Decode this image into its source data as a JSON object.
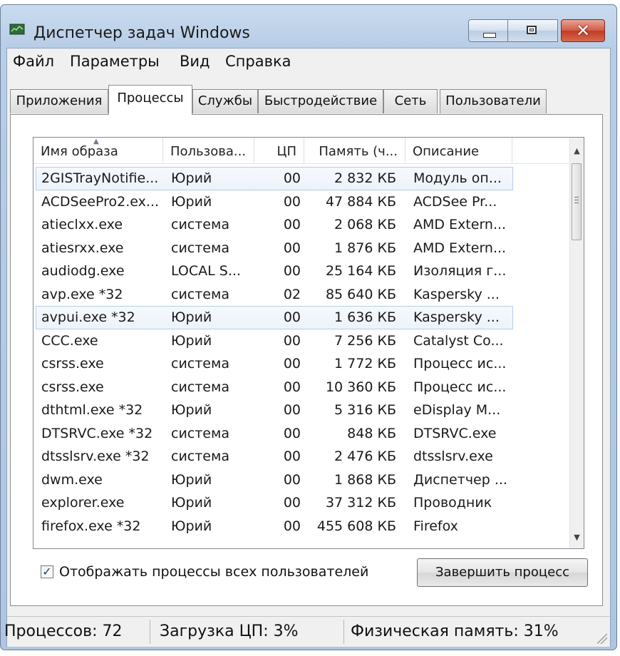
{
  "window": {
    "title": "Диспетчер задач Windows",
    "close_glyph": "✕"
  },
  "menu": [
    "Файл",
    "Параметры",
    "Вид",
    "Справка"
  ],
  "tabs": [
    "Приложения",
    "Процессы",
    "Службы",
    "Быстродействие",
    "Сеть",
    "Пользователи"
  ],
  "active_tab": "Процессы",
  "columns": {
    "name": "Имя образа",
    "user": "Пользова...",
    "cpu": "ЦП",
    "memory": "Память (ч...",
    "description": "Описание"
  },
  "processes": [
    {
      "name": "2GISTrayNotifie...",
      "user": "Юрий",
      "cpu": "00",
      "memory": "2 832 КБ",
      "description": "Модуль оп...",
      "selected": true
    },
    {
      "name": "ACDSeePro2.ex...",
      "user": "Юрий",
      "cpu": "00",
      "memory": "47 884 КБ",
      "description": "ACDSee Pr..."
    },
    {
      "name": "atieclxx.exe",
      "user": "система",
      "cpu": "00",
      "memory": "2 068 КБ",
      "description": "AMD Extern..."
    },
    {
      "name": "atiesrxx.exe",
      "user": "система",
      "cpu": "00",
      "memory": "1 876 КБ",
      "description": "AMD Extern..."
    },
    {
      "name": "audiodg.exe",
      "user": "LOCAL S...",
      "cpu": "00",
      "memory": "25 164 КБ",
      "description": "Изоляция г..."
    },
    {
      "name": "avp.exe *32",
      "user": "система",
      "cpu": "02",
      "memory": "85 640 КБ",
      "description": "Kaspersky ..."
    },
    {
      "name": "avpui.exe *32",
      "user": "Юрий",
      "cpu": "00",
      "memory": "1 636 КБ",
      "description": "Kaspersky ...",
      "selected": true
    },
    {
      "name": "CCC.exe",
      "user": "Юрий",
      "cpu": "00",
      "memory": "7 256 КБ",
      "description": "Catalyst Co..."
    },
    {
      "name": "csrss.exe",
      "user": "система",
      "cpu": "00",
      "memory": "1 772 КБ",
      "description": "Процесс ис..."
    },
    {
      "name": "csrss.exe",
      "user": "система",
      "cpu": "00",
      "memory": "10 360 КБ",
      "description": "Процесс ис..."
    },
    {
      "name": "dthtml.exe *32",
      "user": "Юрий",
      "cpu": "00",
      "memory": "5 316 КБ",
      "description": "eDisplay M..."
    },
    {
      "name": "DTSRVC.exe *32",
      "user": "система",
      "cpu": "00",
      "memory": "848 КБ",
      "description": "DTSRVC.exe"
    },
    {
      "name": "dtsslsrv.exe *32",
      "user": "система",
      "cpu": "00",
      "memory": "2 476 КБ",
      "description": "dtsslsrv.exe"
    },
    {
      "name": "dwm.exe",
      "user": "Юрий",
      "cpu": "00",
      "memory": "1 868 КБ",
      "description": "Диспетчер ..."
    },
    {
      "name": "explorer.exe",
      "user": "Юрий",
      "cpu": "00",
      "memory": "37 312 КБ",
      "description": "Проводник"
    },
    {
      "name": "firefox.exe *32",
      "user": "Юрий",
      "cpu": "00",
      "memory": "455 608 КБ",
      "description": "Firefox"
    }
  ],
  "show_all_users": {
    "label": "Отображать процессы всех пользователей",
    "checked": true,
    "check_glyph": "✓"
  },
  "end_process_button": "Завершить процесс",
  "status": {
    "processes": "Процессов: 72",
    "cpu": "Загрузка ЦП: 3%",
    "memory": "Физическая память: 31%"
  }
}
